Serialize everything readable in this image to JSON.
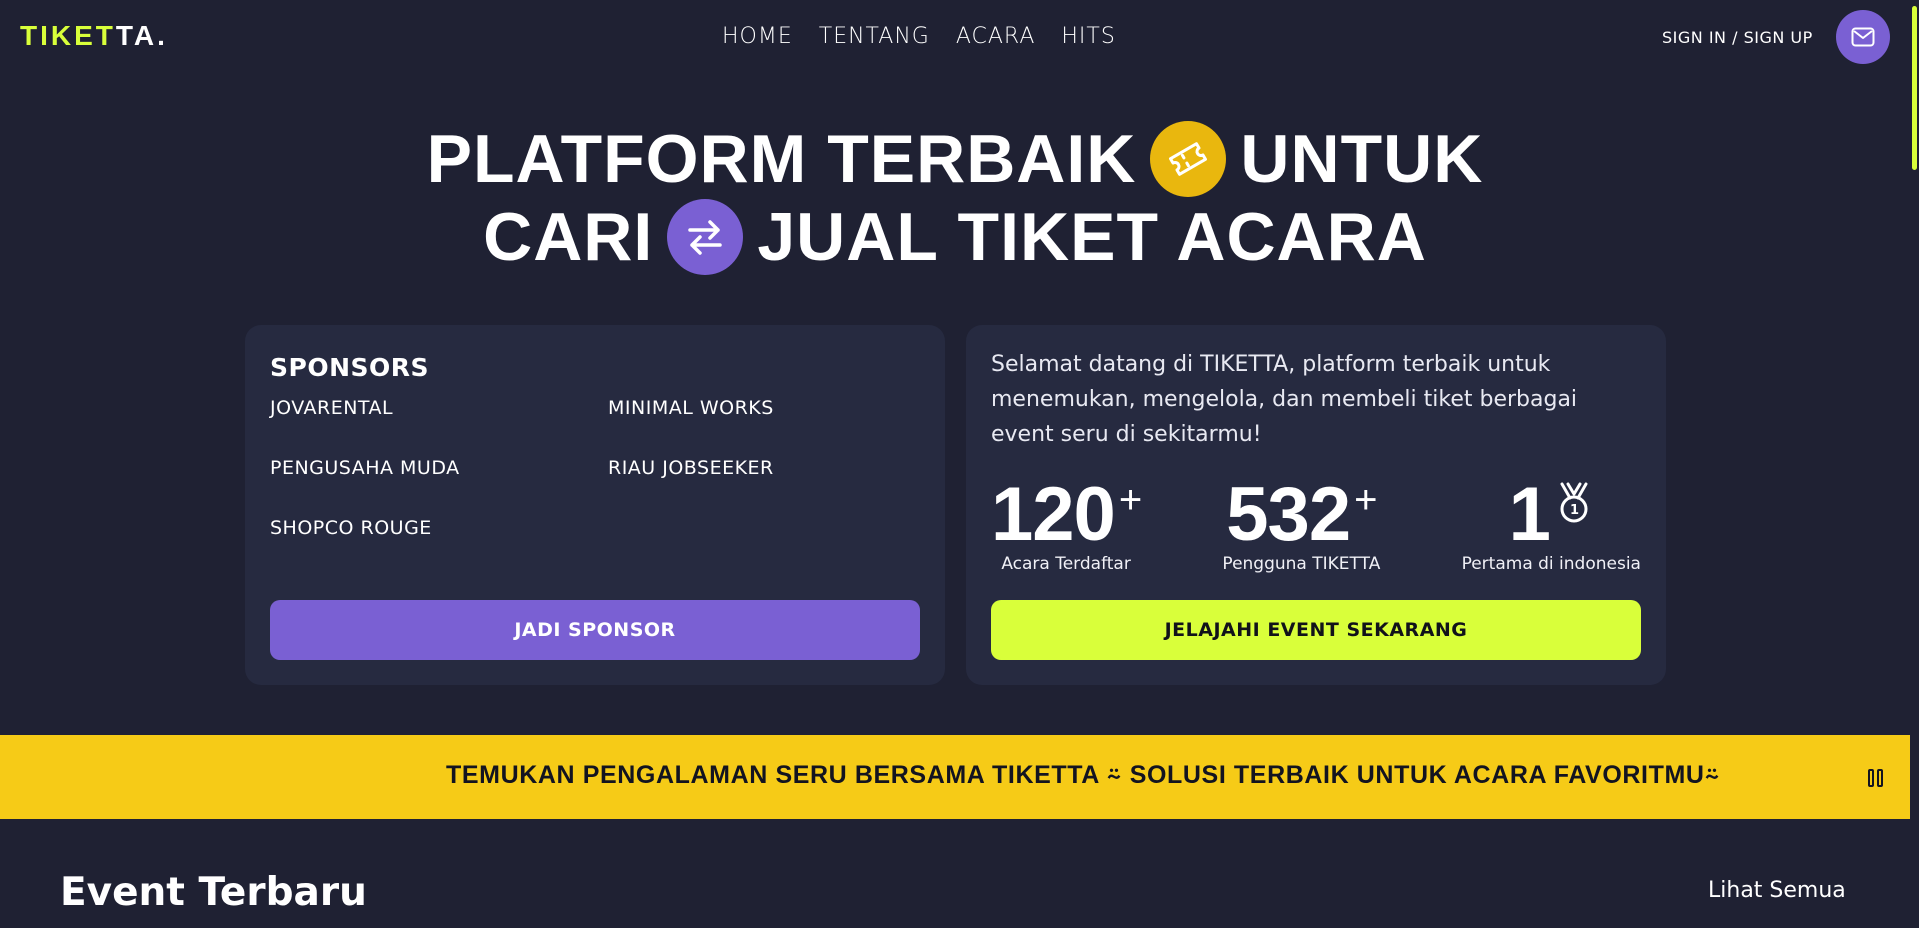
{
  "nav": {
    "logo_lime": "TIKET",
    "logo_white": "TA.",
    "menu": [
      "HOME",
      "TENTANG",
      "ACARA",
      "HITS"
    ],
    "signin_label": "SIGN IN / SIGN UP",
    "mail_icon": "mail-icon"
  },
  "hero": {
    "line1_a": "PLATFORM TERBAIK",
    "line1_b": "UNTUK",
    "line2_a": "CARI",
    "line2_b": "JUAL TIKET ACARA",
    "badge1_icon": "ticket-icon",
    "badge2_icon": "swap-arrows-icon"
  },
  "sponsors": {
    "title": "SPONSORS",
    "items": [
      "JOVARENTAL",
      "MINIMAL WORKS",
      "PENGUSAHA MUDA",
      "RIAU JOBSEEKER",
      "SHOPCO ROUGE"
    ],
    "button_label": "JADI SPONSOR"
  },
  "intro": {
    "welcome": "Selamat datang di TIKETTA, platform terbaik untuk menemukan, mengelola, dan membeli tiket berbagai event seru di sekitarmu!",
    "stats": [
      {
        "number": "120",
        "suffix": "+",
        "label": "Acara Terdaftar"
      },
      {
        "number": "532",
        "suffix": "+",
        "label": "Pengguna TIKETTA"
      },
      {
        "number": "1",
        "suffix_icon": "medal-icon",
        "label": "Pertama di indonesia"
      }
    ],
    "button_label": "JELAJAHI EVENT SEKARANG"
  },
  "marquee": {
    "text": "TEMUKAN PENGALAMAN SERU BERSAMA TIKETTA ⍨ SOLUSI TERBAIK UNTUK ACARA FAVORITMU⍨"
  },
  "section": {
    "title": "Event Terbaru",
    "see_all": "Lihat Semua"
  },
  "colors": {
    "background": "#1f2133",
    "card": "#262a40",
    "lime": "#d9ff3a",
    "purple": "#7a60d3",
    "yellow": "#f6cb17",
    "ticket_badge": "#e9b70e"
  }
}
